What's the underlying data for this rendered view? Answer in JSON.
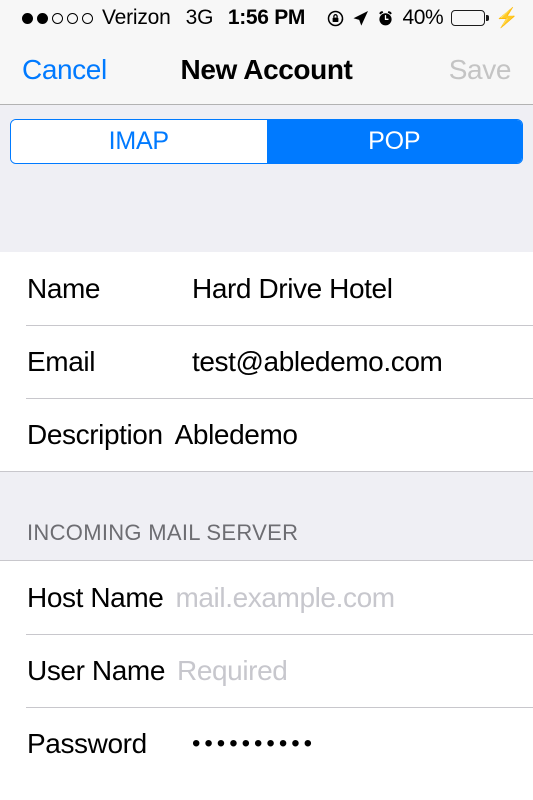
{
  "status_bar": {
    "signal_dots_filled": 2,
    "signal_dots_total": 5,
    "carrier": "Verizon",
    "network": "3G",
    "time": "1:56 PM",
    "rotation_lock_icon": "rotation-lock-icon",
    "location_icon": "location-arrow-icon",
    "alarm_icon": "alarm-clock-icon",
    "battery_percent": "40%",
    "battery_level": 40,
    "battery_fill_color": "#4cd964",
    "charging_icon": "lightning-bolt-icon"
  },
  "nav_bar": {
    "cancel_label": "Cancel",
    "title": "New Account",
    "save_label": "Save",
    "cancel_color": "#007aff",
    "save_color": "#c4c4c4"
  },
  "segmented_control": {
    "accent_color": "#007aff",
    "options": [
      {
        "label": "IMAP",
        "selected": false
      },
      {
        "label": "POP",
        "selected": true
      }
    ]
  },
  "account_section": {
    "rows": [
      {
        "label": "Name",
        "value": "Hard Drive Hotel",
        "is_placeholder": false
      },
      {
        "label": "Email",
        "value": "test@abledemo.com",
        "is_placeholder": false
      },
      {
        "label": "Description",
        "value": "Abledemo",
        "is_placeholder": false
      }
    ]
  },
  "incoming_section": {
    "header": "INCOMING MAIL SERVER",
    "rows": [
      {
        "label": "Host Name",
        "value": "mail.example.com",
        "is_placeholder": true
      },
      {
        "label": "User Name",
        "value": "Required",
        "is_placeholder": true
      },
      {
        "label": "Password",
        "value": "••••••••••",
        "is_placeholder": false
      }
    ]
  }
}
